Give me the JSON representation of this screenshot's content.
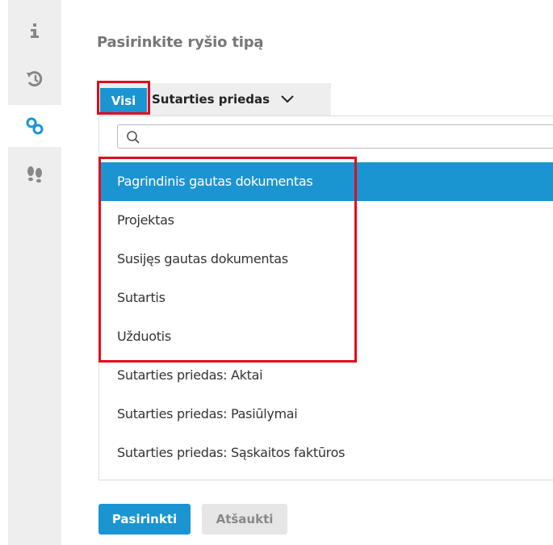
{
  "sidebar": {
    "icons": [
      {
        "name": "info-icon",
        "active": false
      },
      {
        "name": "history-icon",
        "active": false
      },
      {
        "name": "link-icon",
        "active": true,
        "color": "#1a95d2"
      },
      {
        "name": "footsteps-icon",
        "active": false
      }
    ]
  },
  "dialog": {
    "title": "Pasirinkite ryšio tipą"
  },
  "tabs": {
    "all_label": "Visi",
    "filter_label": "Sutarties priedas"
  },
  "search": {
    "value": "",
    "placeholder": ""
  },
  "options": [
    {
      "label": "Pagrindinis gautas dokumentas",
      "selected": true
    },
    {
      "label": "Projektas",
      "selected": false
    },
    {
      "label": "Susijęs gautas dokumentas",
      "selected": false
    },
    {
      "label": "Sutartis",
      "selected": false
    },
    {
      "label": "Užduotis",
      "selected": false
    },
    {
      "label": "Sutarties priedas: Aktai",
      "selected": false
    },
    {
      "label": "Sutarties priedas: Pasiūlymai",
      "selected": false
    },
    {
      "label": "Sutarties priedas: Sąskaitos faktūros",
      "selected": false
    }
  ],
  "footer": {
    "select_label": "Pasirinkti",
    "cancel_label": "Atšaukti"
  },
  "colors": {
    "accent": "#1a95d2",
    "highlight_outline": "#e10b1e",
    "rail_background": "#eeeeee"
  }
}
